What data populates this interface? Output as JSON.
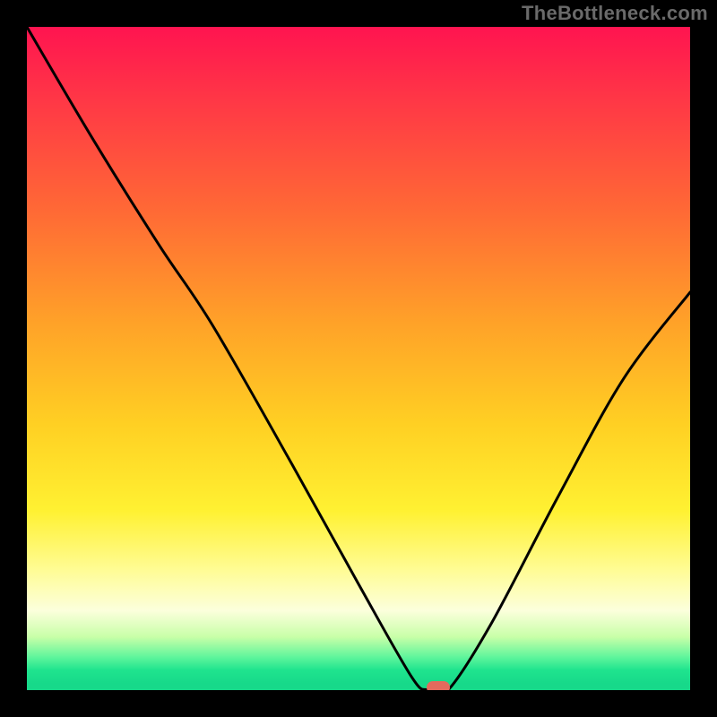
{
  "watermark": "TheBottleneck.com",
  "colors": {
    "frame": "#000000",
    "curve": "#000000",
    "marker": "#e36a5d",
    "gradient_stops": [
      "#ff1450",
      "#ff3a45",
      "#ff6a35",
      "#ffa328",
      "#ffd023",
      "#fff132",
      "#fffc96",
      "#fcffdc",
      "#c8ffa8",
      "#60f59c",
      "#1fe48e",
      "#17d98a"
    ]
  },
  "chart_data": {
    "type": "line",
    "title": "",
    "xlabel": "",
    "ylabel": "",
    "xlim": [
      0,
      100
    ],
    "ylim": [
      0,
      100
    ],
    "marker": {
      "x": 62,
      "y": 0,
      "width_x": 3
    },
    "series": [
      {
        "name": "bottleneck-curve",
        "x": [
          0,
          10,
          20,
          28,
          40,
          50,
          58,
          60.5,
          63.5,
          70,
          80,
          90,
          100
        ],
        "y": [
          100,
          83,
          67,
          55,
          34,
          16,
          2,
          0,
          0,
          10,
          29,
          47,
          60
        ]
      }
    ],
    "annotations": []
  }
}
